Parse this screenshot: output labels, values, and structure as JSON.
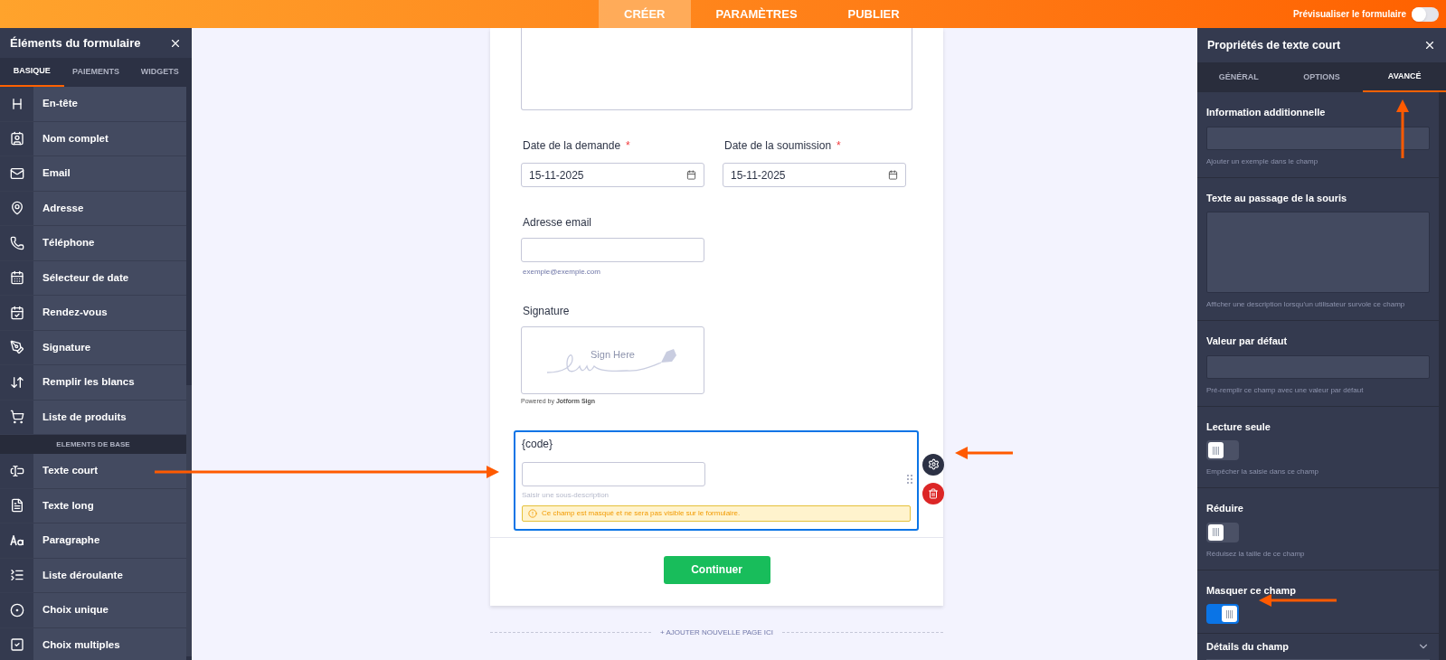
{
  "top_bar": {
    "tabs": [
      {
        "label": "CRÉER",
        "selected": true
      },
      {
        "label": "PARAMÈTRES",
        "selected": false
      },
      {
        "label": "PUBLIER",
        "selected": false
      }
    ],
    "preview": {
      "label": "Prévisualiser le formulaire",
      "on": false
    }
  },
  "left_panel": {
    "title": "Éléments du formulaire",
    "tabs": [
      {
        "label": "BASIQUE",
        "selected": true
      },
      {
        "label": "PAIEMENTS",
        "selected": false
      },
      {
        "label": "WIDGETS",
        "selected": false
      }
    ],
    "groups": [
      {
        "items": [
          "En-tête",
          "Nom complet",
          "Email",
          "Adresse",
          "Téléphone",
          "Sélecteur de date",
          "Rendez-vous",
          "Signature",
          "Remplir les blancs",
          "Liste de produits"
        ]
      },
      {
        "heading": "ELEMENTS DE BASE",
        "items": [
          "Texte court",
          "Texte long",
          "Paragraphe",
          "Liste déroulante",
          "Choix unique",
          "Choix multiples"
        ]
      }
    ]
  },
  "form": {
    "date_fields": [
      {
        "label": "Date de la demande",
        "required_mark": "*",
        "value": "15-11-2025"
      },
      {
        "label": "Date de la soumission",
        "required_mark": "*",
        "value": "15-11-2025"
      }
    ],
    "email": {
      "label": "Adresse email",
      "sublabel": "exemple@exemple.com"
    },
    "signature": {
      "label": "Signature",
      "pad_text": "Sign Here",
      "powered_by": "Powered by **Jotform Sign**"
    },
    "selected_field": {
      "label": "{code}",
      "sublabel_placeholder": "Saisir une sous-description",
      "warning": "Ce champ est masqué et ne sera pas visible sur le formulaire."
    },
    "submit": "Continuer",
    "add_page": "+ AJOUTER NOUVELLE PAGE ICI"
  },
  "right_panel": {
    "title": "Propriétés de texte court",
    "tabs": [
      {
        "label": "GÉNÉRAL",
        "selected": false
      },
      {
        "label": "OPTIONS",
        "selected": false
      },
      {
        "label": "AVANCÉ",
        "selected": true
      }
    ],
    "settings": [
      {
        "kind": "text",
        "label": "Information additionnelle",
        "hint": "Ajouter un exemple dans le champ"
      },
      {
        "kind": "textarea",
        "label": "Texte au passage de la souris",
        "hint": "Afficher une description lorsqu'un utilisateur survole ce champ"
      },
      {
        "kind": "text",
        "label": "Valeur par défaut",
        "hint": "Pré-remplir ce champ avec une valeur par défaut"
      },
      {
        "kind": "toggle",
        "label": "Lecture seule",
        "on": false,
        "hint": "Empêcher la saisie dans ce champ"
      },
      {
        "kind": "toggle",
        "label": "Réduire",
        "on": false,
        "hint": "Réduisez la taille de ce champ"
      },
      {
        "kind": "toggle",
        "label": "Masquer ce champ",
        "on": true
      },
      {
        "kind": "accordion",
        "label": "Détails du champ",
        "expanded": false
      }
    ]
  }
}
